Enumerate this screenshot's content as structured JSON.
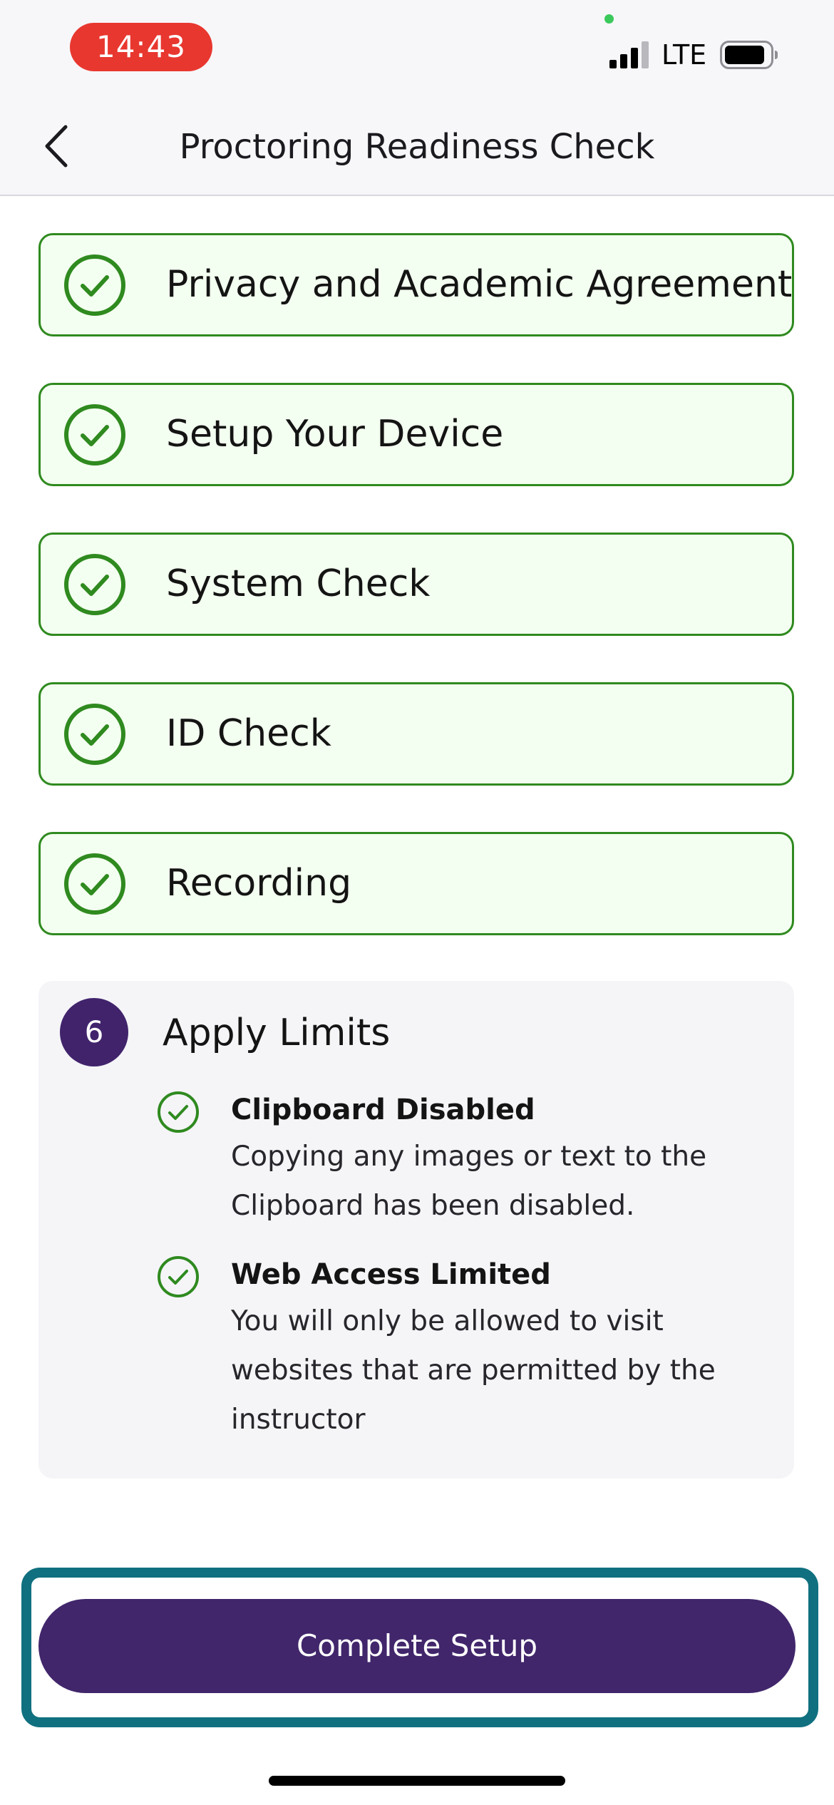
{
  "status_bar": {
    "time": "14:43",
    "network": "LTE",
    "time_pill_color": "#e8372f",
    "camera_indicator_color": "#3cc95b",
    "signal_icon": "cellular-signal-icon",
    "battery_icon": "battery-icon"
  },
  "header": {
    "title": "Proctoring Readiness Check",
    "back_icon": "chevron-left-icon"
  },
  "steps": [
    {
      "label": "Privacy and Academic Agreement",
      "status": "complete"
    },
    {
      "label": "Setup Your Device",
      "status": "complete"
    },
    {
      "label": "System Check",
      "status": "complete"
    },
    {
      "label": "ID Check",
      "status": "complete"
    },
    {
      "label": "Recording",
      "status": "complete"
    }
  ],
  "current_step": {
    "number": "6",
    "title": "Apply Limits",
    "items": [
      {
        "title": "Clipboard Disabled",
        "description": "Copying any images or text to the Clipboard has been disabled."
      },
      {
        "title": "Web Access Limited",
        "description": "You will only be allowed to visit websites that are permitted by the instructor"
      }
    ]
  },
  "actions": {
    "complete_label": "Complete Setup"
  },
  "colors": {
    "complete_green": "#2f8a1f",
    "card_background": "#f3fff0",
    "brand_purple": "#41266b",
    "focus_teal": "#10707f"
  }
}
